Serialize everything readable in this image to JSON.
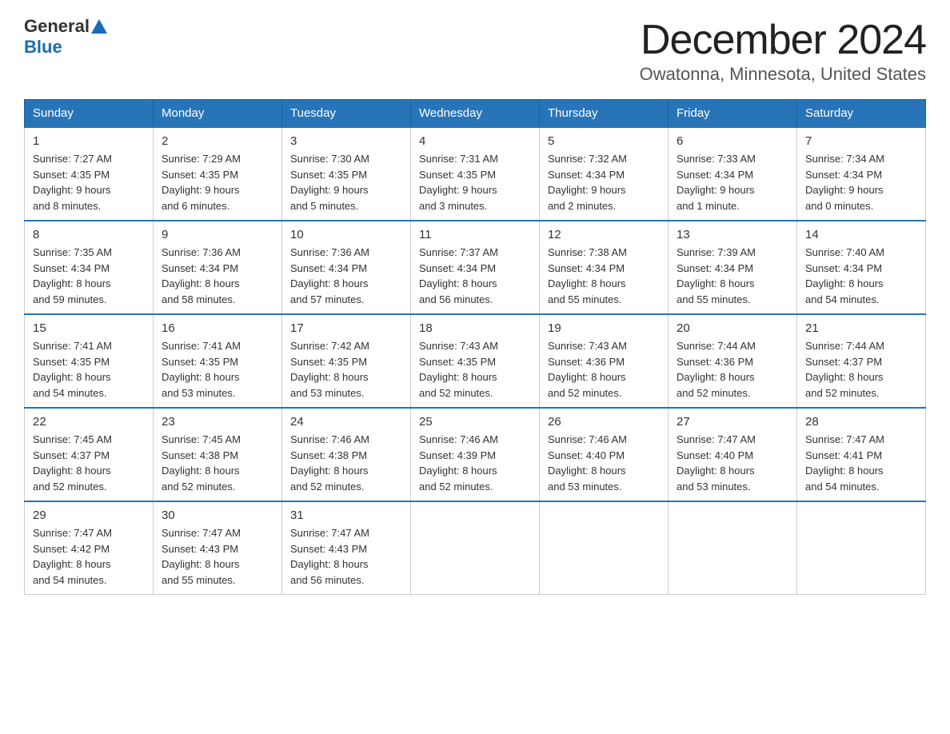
{
  "header": {
    "logo": {
      "general": "General",
      "blue": "Blue"
    },
    "title": "December 2024",
    "location": "Owatonna, Minnesota, United States"
  },
  "days_of_week": [
    "Sunday",
    "Monday",
    "Tuesday",
    "Wednesday",
    "Thursday",
    "Friday",
    "Saturday"
  ],
  "weeks": [
    [
      {
        "day": "1",
        "sunrise": "7:27 AM",
        "sunset": "4:35 PM",
        "daylight": "9 hours and 8 minutes."
      },
      {
        "day": "2",
        "sunrise": "7:29 AM",
        "sunset": "4:35 PM",
        "daylight": "9 hours and 6 minutes."
      },
      {
        "day": "3",
        "sunrise": "7:30 AM",
        "sunset": "4:35 PM",
        "daylight": "9 hours and 5 minutes."
      },
      {
        "day": "4",
        "sunrise": "7:31 AM",
        "sunset": "4:35 PM",
        "daylight": "9 hours and 3 minutes."
      },
      {
        "day": "5",
        "sunrise": "7:32 AM",
        "sunset": "4:34 PM",
        "daylight": "9 hours and 2 minutes."
      },
      {
        "day": "6",
        "sunrise": "7:33 AM",
        "sunset": "4:34 PM",
        "daylight": "9 hours and 1 minute."
      },
      {
        "day": "7",
        "sunrise": "7:34 AM",
        "sunset": "4:34 PM",
        "daylight": "9 hours and 0 minutes."
      }
    ],
    [
      {
        "day": "8",
        "sunrise": "7:35 AM",
        "sunset": "4:34 PM",
        "daylight": "8 hours and 59 minutes."
      },
      {
        "day": "9",
        "sunrise": "7:36 AM",
        "sunset": "4:34 PM",
        "daylight": "8 hours and 58 minutes."
      },
      {
        "day": "10",
        "sunrise": "7:36 AM",
        "sunset": "4:34 PM",
        "daylight": "8 hours and 57 minutes."
      },
      {
        "day": "11",
        "sunrise": "7:37 AM",
        "sunset": "4:34 PM",
        "daylight": "8 hours and 56 minutes."
      },
      {
        "day": "12",
        "sunrise": "7:38 AM",
        "sunset": "4:34 PM",
        "daylight": "8 hours and 55 minutes."
      },
      {
        "day": "13",
        "sunrise": "7:39 AM",
        "sunset": "4:34 PM",
        "daylight": "8 hours and 55 minutes."
      },
      {
        "day": "14",
        "sunrise": "7:40 AM",
        "sunset": "4:34 PM",
        "daylight": "8 hours and 54 minutes."
      }
    ],
    [
      {
        "day": "15",
        "sunrise": "7:41 AM",
        "sunset": "4:35 PM",
        "daylight": "8 hours and 54 minutes."
      },
      {
        "day": "16",
        "sunrise": "7:41 AM",
        "sunset": "4:35 PM",
        "daylight": "8 hours and 53 minutes."
      },
      {
        "day": "17",
        "sunrise": "7:42 AM",
        "sunset": "4:35 PM",
        "daylight": "8 hours and 53 minutes."
      },
      {
        "day": "18",
        "sunrise": "7:43 AM",
        "sunset": "4:35 PM",
        "daylight": "8 hours and 52 minutes."
      },
      {
        "day": "19",
        "sunrise": "7:43 AM",
        "sunset": "4:36 PM",
        "daylight": "8 hours and 52 minutes."
      },
      {
        "day": "20",
        "sunrise": "7:44 AM",
        "sunset": "4:36 PM",
        "daylight": "8 hours and 52 minutes."
      },
      {
        "day": "21",
        "sunrise": "7:44 AM",
        "sunset": "4:37 PM",
        "daylight": "8 hours and 52 minutes."
      }
    ],
    [
      {
        "day": "22",
        "sunrise": "7:45 AM",
        "sunset": "4:37 PM",
        "daylight": "8 hours and 52 minutes."
      },
      {
        "day": "23",
        "sunrise": "7:45 AM",
        "sunset": "4:38 PM",
        "daylight": "8 hours and 52 minutes."
      },
      {
        "day": "24",
        "sunrise": "7:46 AM",
        "sunset": "4:38 PM",
        "daylight": "8 hours and 52 minutes."
      },
      {
        "day": "25",
        "sunrise": "7:46 AM",
        "sunset": "4:39 PM",
        "daylight": "8 hours and 52 minutes."
      },
      {
        "day": "26",
        "sunrise": "7:46 AM",
        "sunset": "4:40 PM",
        "daylight": "8 hours and 53 minutes."
      },
      {
        "day": "27",
        "sunrise": "7:47 AM",
        "sunset": "4:40 PM",
        "daylight": "8 hours and 53 minutes."
      },
      {
        "day": "28",
        "sunrise": "7:47 AM",
        "sunset": "4:41 PM",
        "daylight": "8 hours and 54 minutes."
      }
    ],
    [
      {
        "day": "29",
        "sunrise": "7:47 AM",
        "sunset": "4:42 PM",
        "daylight": "8 hours and 54 minutes."
      },
      {
        "day": "30",
        "sunrise": "7:47 AM",
        "sunset": "4:43 PM",
        "daylight": "8 hours and 55 minutes."
      },
      {
        "day": "31",
        "sunrise": "7:47 AM",
        "sunset": "4:43 PM",
        "daylight": "8 hours and 56 minutes."
      },
      null,
      null,
      null,
      null
    ]
  ],
  "labels": {
    "sunrise_prefix": "Sunrise: ",
    "sunset_prefix": "Sunset: ",
    "daylight_prefix": "Daylight: "
  }
}
